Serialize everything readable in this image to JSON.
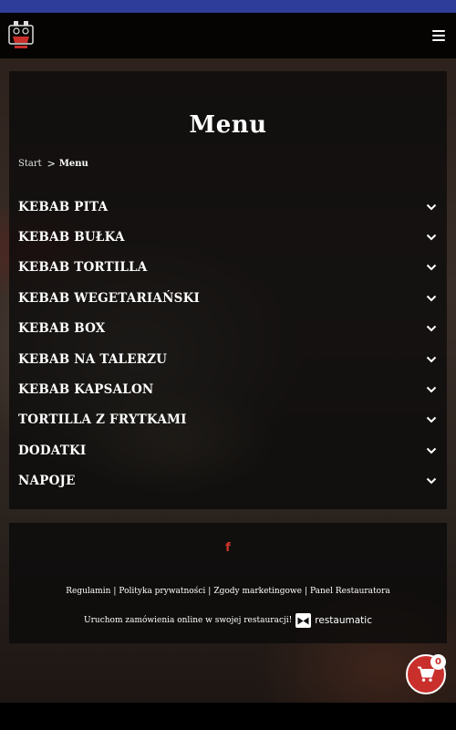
{
  "header": {
    "logo_icon": "restaurant-logo-icon",
    "menu_icon": "hamburger-menu-icon"
  },
  "page": {
    "title": "Menu",
    "breadcrumb": {
      "start": "Start",
      "separator": ">",
      "current": "Menu"
    }
  },
  "categories": [
    {
      "label": "KEBAB PITA",
      "icon": "chevron-down-icon"
    },
    {
      "label": "KEBAB BUŁKA",
      "icon": "chevron-down-icon"
    },
    {
      "label": "KEBAB TORTILLA",
      "icon": "chevron-down-icon"
    },
    {
      "label": "KEBAB WEGETARIAŃSKI",
      "icon": "chevron-down-icon"
    },
    {
      "label": "KEBAB BOX",
      "icon": "chevron-down-icon"
    },
    {
      "label": "KEBAB NA TALERZU",
      "icon": "chevron-down-icon"
    },
    {
      "label": "KEBAB KAPSALON",
      "icon": "chevron-down-icon"
    },
    {
      "label": "TORTILLA Z FRYTKAMI",
      "icon": "chevron-down-icon"
    },
    {
      "label": "DODATKI",
      "icon": "chevron-down-icon"
    },
    {
      "label": "NAPOJE",
      "icon": "chevron-down-icon"
    }
  ],
  "footer": {
    "social_icon": "facebook-icon",
    "social_glyph": "f",
    "links": [
      "Regulamin",
      "Polityka prywatności",
      "Zgody marketingowe",
      "Panel Restauratora"
    ],
    "link_separator": "|",
    "promo_text": "Uruchom zamówienia online w swojej restauracji!",
    "brand_name": "restaumatic"
  },
  "cart": {
    "count": "0",
    "icon": "shopping-cart-icon"
  },
  "colors": {
    "top_strip": "#2f3d9a",
    "accent_red": "#c9302c",
    "facebook_red": "#d0362c"
  }
}
